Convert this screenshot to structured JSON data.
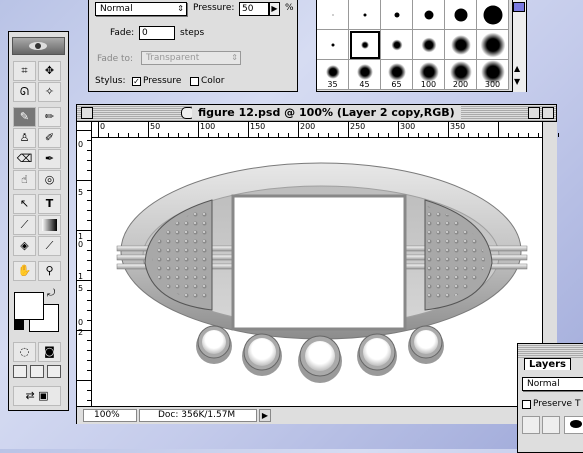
{
  "options_palette": {
    "mode": "Normal",
    "pressure_label": "Pressure:",
    "pressure_value": "50",
    "pressure_unit": "%",
    "fade_label": "Fade:",
    "fade_value": "0",
    "fade_unit": "steps",
    "fade_to_label": "Fade to:",
    "fade_to_value": "Transparent",
    "stylus_label": "Stylus:",
    "stylus_pressure": "Pressure",
    "stylus_color": "Color"
  },
  "brushes_palette": {
    "sizes": [
      "35",
      "45",
      "65",
      "100",
      "200",
      "300"
    ]
  },
  "document": {
    "title": "figure 12.psd @ 100% (Layer 2 copy,RGB)",
    "ruler_h": [
      "0",
      "50",
      "100",
      "150",
      "200",
      "250",
      "300",
      "350"
    ],
    "ruler_v": [
      "0",
      "5",
      "1",
      "0",
      "1",
      "5",
      "0",
      "2"
    ],
    "zoom": "100%",
    "doc_info": "Doc: 356K/1.57M"
  },
  "layers_palette": {
    "tab_label": "Layers",
    "mode": "Normal",
    "preserve_label": "Preserve T"
  },
  "colors": {
    "desktop": "#c4cbeb",
    "palette_bg": "#dedede",
    "object_gray": "#b8b8b8"
  }
}
